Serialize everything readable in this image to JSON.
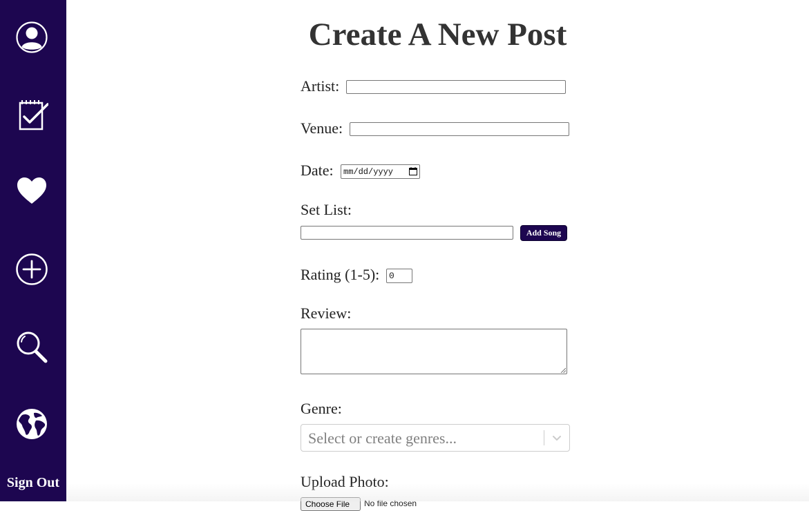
{
  "sidebar": {
    "items": [
      {
        "icon": "profile-icon",
        "label": ""
      },
      {
        "icon": "checklist-icon",
        "label": ""
      },
      {
        "icon": "heart-icon",
        "label": ""
      },
      {
        "icon": "add-circle-icon",
        "label": ""
      },
      {
        "icon": "search-icon",
        "label": ""
      },
      {
        "icon": "globe-icon",
        "label": ""
      }
    ],
    "sign_out": "Sign Out",
    "background": "#1d0650"
  },
  "main": {
    "title": "Create A New Post",
    "artist_label": "Artist:",
    "artist_value": "",
    "venue_label": "Venue:",
    "venue_value": "",
    "date_label": "Date:",
    "date_placeholder": "mm/dd/yyyy",
    "setlist_label": "Set List:",
    "setlist_value": "",
    "add_song": "Add Song",
    "rating_label": "Rating (1-5):",
    "rating_value": "0",
    "review_label": "Review:",
    "review_value": "",
    "genre_label": "Genre:",
    "genre_placeholder": "Select or create genres...",
    "upload_label": "Upload Photo:",
    "file_button": "Choose File",
    "file_status": "No file chosen"
  }
}
